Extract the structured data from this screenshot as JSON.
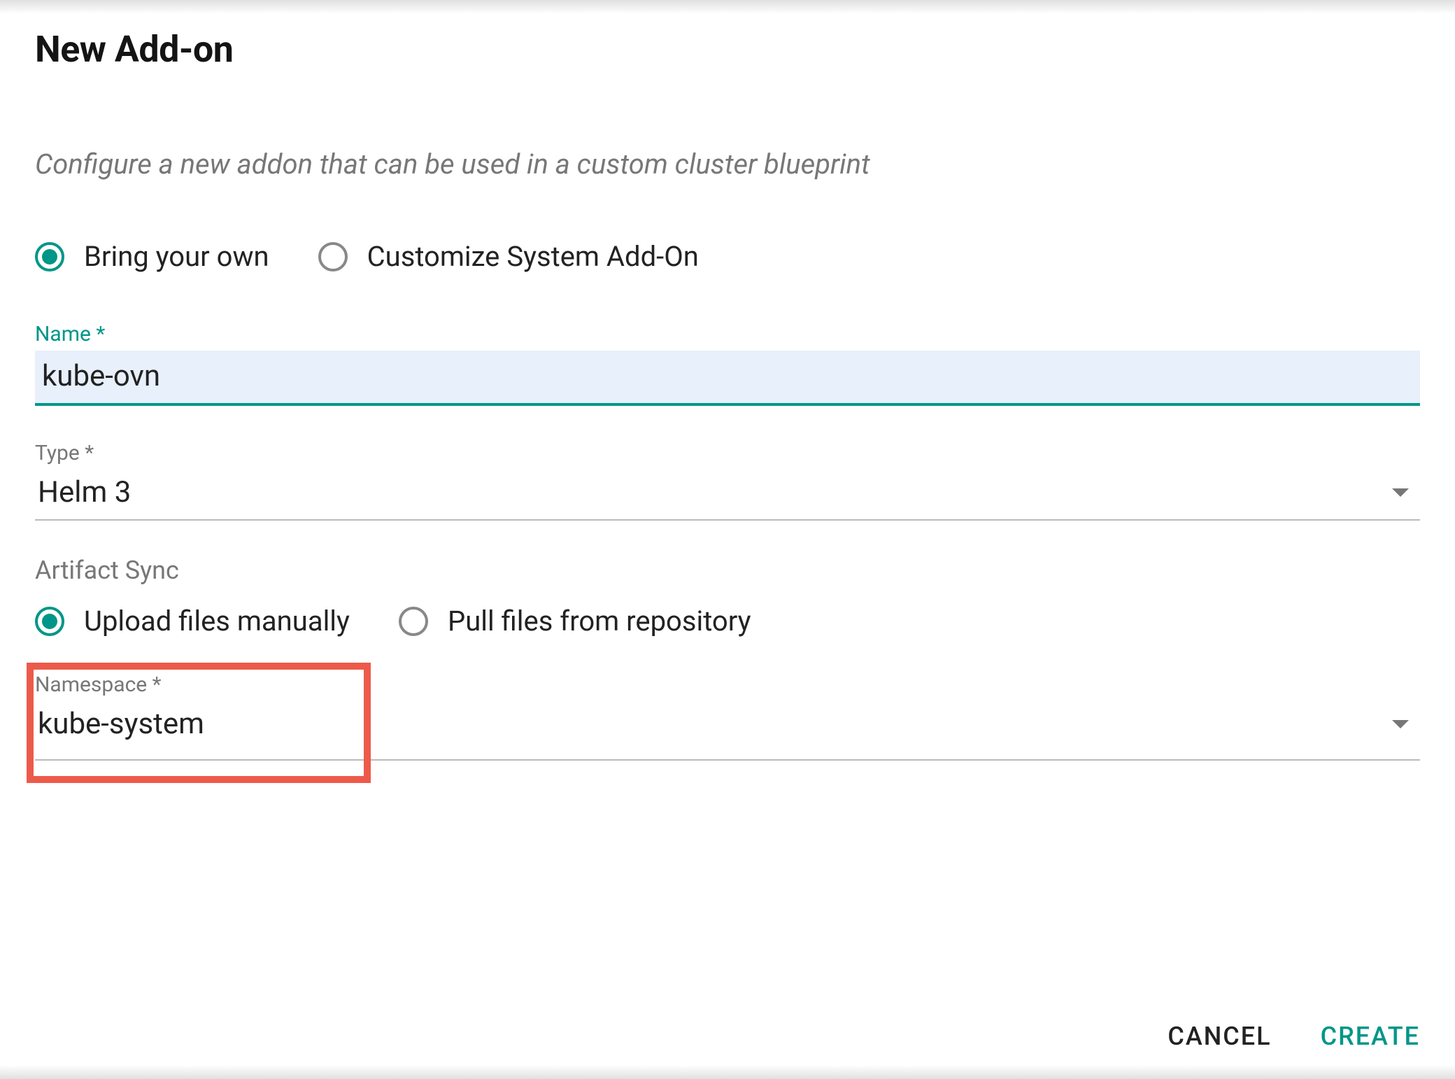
{
  "header": {
    "title": "New Add-on",
    "subtitle": "Configure a new addon that can be used in a custom cluster blueprint"
  },
  "addon_type_radio": {
    "options": [
      {
        "label": "Bring your own",
        "selected": true
      },
      {
        "label": "Customize System Add-On",
        "selected": false
      }
    ]
  },
  "name_field": {
    "label": "Name *",
    "value": "kube-ovn"
  },
  "type_field": {
    "label": "Type *",
    "value": "Helm 3"
  },
  "artifact_sync": {
    "label": "Artifact Sync",
    "options": [
      {
        "label": "Upload files manually",
        "selected": true
      },
      {
        "label": "Pull files from repository",
        "selected": false
      }
    ]
  },
  "namespace_field": {
    "label": "Namespace *",
    "value": "kube-system"
  },
  "footer": {
    "cancel": "CANCEL",
    "create": "CREATE"
  }
}
